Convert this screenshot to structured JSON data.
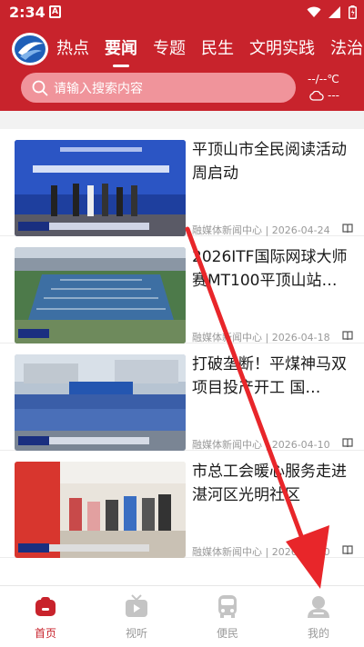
{
  "status_bar": {
    "time": "2:34"
  },
  "nav": {
    "tabs": [
      {
        "label": "热点"
      },
      {
        "label": "要闻"
      },
      {
        "label": "专题"
      },
      {
        "label": "民生"
      },
      {
        "label": "文明实践"
      },
      {
        "label": "法治"
      }
    ],
    "active_index": 1
  },
  "search": {
    "placeholder": "请输入搜索内容"
  },
  "weather": {
    "temp": "--/--℃",
    "condition": "---"
  },
  "news": [
    {
      "title": "平顶山市全民阅读活动周启动",
      "source": "融媒体新闻中心",
      "date": "2026-04-24"
    },
    {
      "title": "2026ITF国际网球大师赛MT100平顶山站…",
      "source": "融媒体新闻中心",
      "date": "2026-04-18"
    },
    {
      "title": "打破垄断！平煤神马双项目投产开工 国…",
      "source": "融媒体新闻中心",
      "date": "2026-04-10"
    },
    {
      "title": "市总工会暖心服务走进湛河区光明社区",
      "source": "融媒体新闻中心",
      "date": "2026-04-10"
    }
  ],
  "bottom_nav": [
    {
      "label": "首页",
      "icon": "home-icon"
    },
    {
      "label": "视听",
      "icon": "tv-icon"
    },
    {
      "label": "便民",
      "icon": "bus-icon"
    },
    {
      "label": "我的",
      "icon": "user-icon"
    }
  ],
  "colors": {
    "brand_red": "#c8232c",
    "annotation_red": "#e8262a"
  }
}
